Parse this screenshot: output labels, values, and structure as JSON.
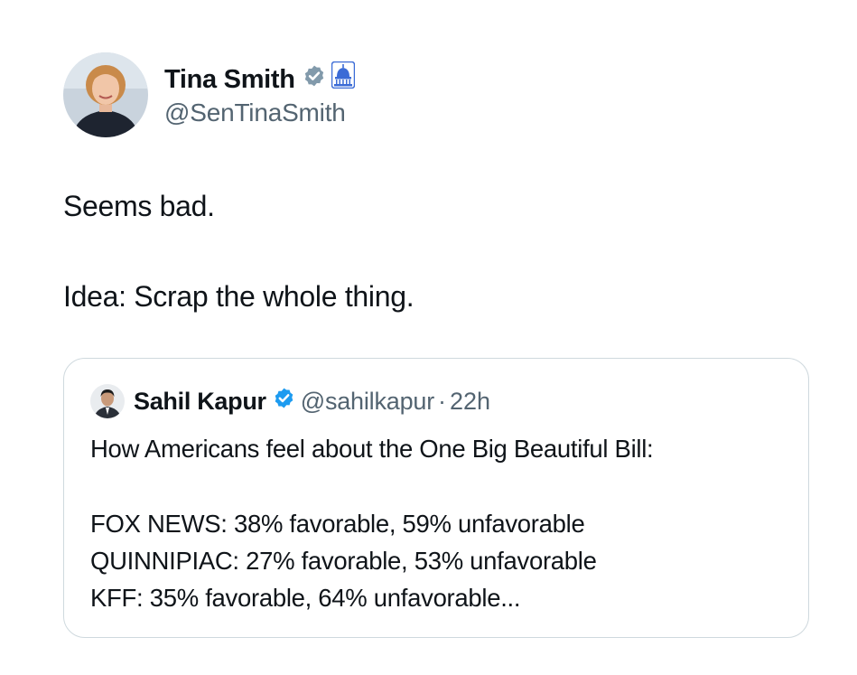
{
  "post": {
    "author": {
      "name": "Tina Smith",
      "handle": "@SenTinaSmith",
      "verified_icon": "verified-badge-icon",
      "affiliation_icon": "capitol-dome-icon",
      "badge_color": "#829aab",
      "affiliation_color": "#3b6bd6"
    },
    "text_lines": [
      "Seems bad.",
      "Idea: Scrap the whole thing."
    ]
  },
  "quoted_post": {
    "author": {
      "name": "Sahil Kapur",
      "handle": "@sahilkapur",
      "separator": "·",
      "time": "22h",
      "verified_icon": "verified-badge-icon",
      "badge_color": "#1d9bf0"
    },
    "text_lines": [
      "How Americans feel about the One Big Beautiful Bill:",
      "FOX NEWS: 38% favorable, 59% unfavorable",
      "QUINNIPIAC: 27% favorable, 53% unfavorable",
      "KFF: 35% favorable, 64% unfavorable..."
    ]
  }
}
